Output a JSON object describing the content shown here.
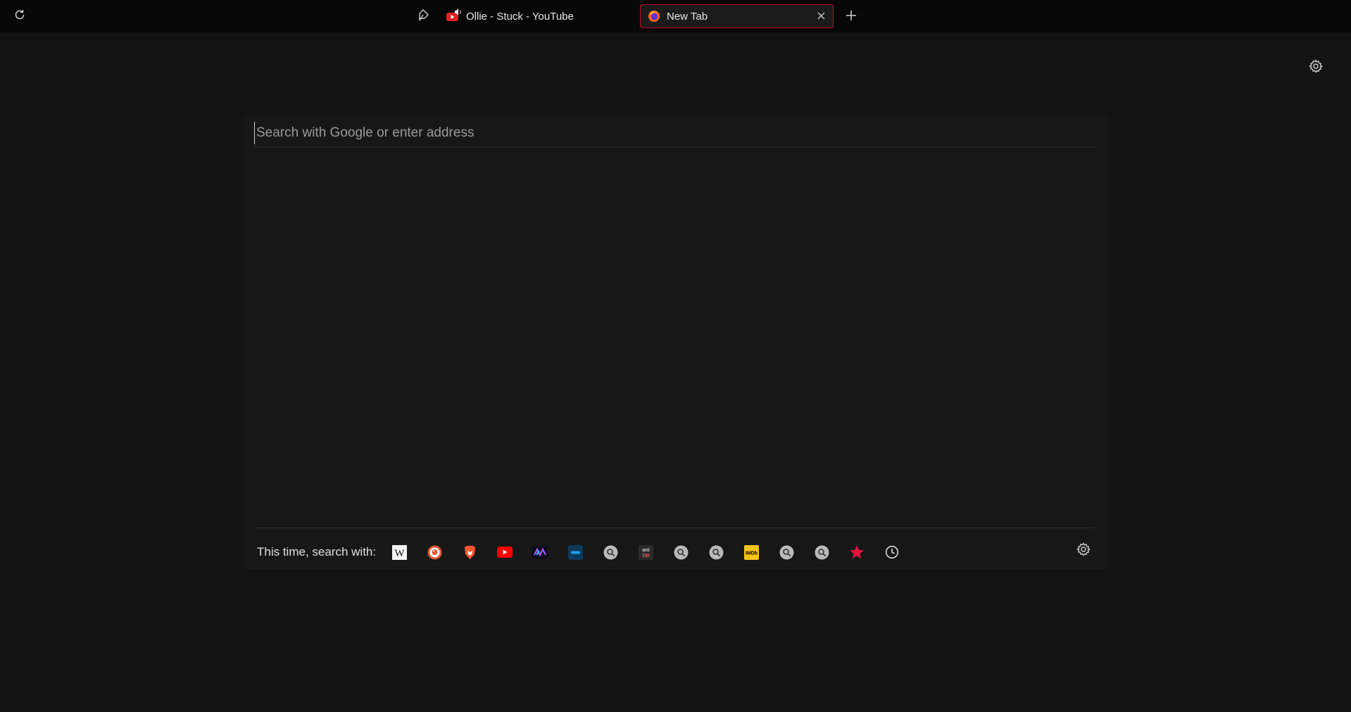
{
  "tabs": [
    {
      "title": "Ollie - Stuck - YouTube",
      "favicon": "youtube-icon",
      "audio": "speaker-icon",
      "active": false
    },
    {
      "title": "New Tab",
      "favicon": "firefox-icon",
      "active": true
    }
  ],
  "toolbar": {
    "reload_icon": "reload-icon",
    "pin_icon": "pin-icon",
    "newtab_icon": "plus-icon",
    "close_icon": "close-icon"
  },
  "search": {
    "placeholder": "Search with Google or enter address",
    "value": ""
  },
  "engines": {
    "label": "This time, search with:",
    "items": [
      "wikipedia-icon",
      "duckduckgo-icon",
      "brave-icon",
      "youtube-icon",
      "nebula-icon",
      "engine-icon",
      "magnifier-icon",
      "anidb-icon",
      "magnifier-icon",
      "magnifier-icon",
      "imdb-icon",
      "magnifier-icon",
      "magnifier-icon",
      "bookmarks-star-icon",
      "history-clock-icon"
    ],
    "anidb_text": "ani DB",
    "imdb_text": "IMDb",
    "wiki_text": "W"
  },
  "colors": {
    "background": "#131313",
    "tabbar": "#070707",
    "panel": "#171717",
    "accent": "#c3072b"
  }
}
